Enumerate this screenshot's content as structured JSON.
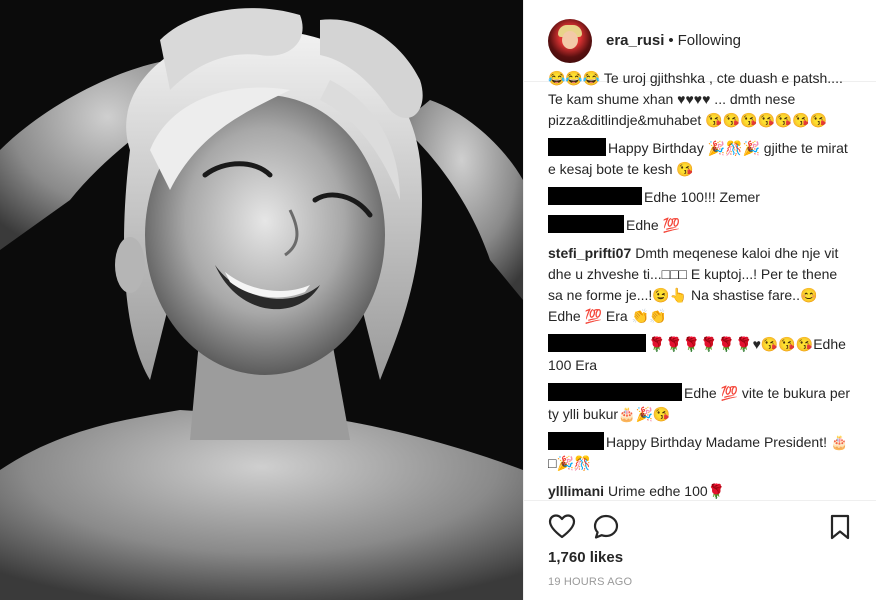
{
  "header": {
    "username": "era_rusi",
    "separator": "•",
    "follow_status": "Following"
  },
  "comments": [
    {
      "author": "",
      "text": "😂😂😂 Te uroj gjithshka , cte duash e patsh.... Te kam shume xhan ♥♥♥♥ ... dmth nese pizza&ditlindje&muhabet 😘😘😘😘😘😘😘"
    },
    {
      "author": "",
      "text": "Happy Birthday 🎉🎊🎉 gjithe te mirat e kesaj bote te kesh 😘"
    },
    {
      "author": "",
      "text": "Edhe 100!!! Zemer"
    },
    {
      "author": "",
      "text": "Edhe 💯"
    },
    {
      "author": "stefi_prifti07",
      "text": "Dmth meqenese kaloi dhe nje vit dhe u zhveshe ti...□□□ E kuptoj...! Per te thene sa ne forme je...!😉👆 Na shastise fare..😊 Edhe 💯 Era 👏👏"
    },
    {
      "author": "",
      "text": "🌹🌹🌹🌹🌹🌹♥😘😘😘Edhe 100 Era"
    },
    {
      "author": "",
      "text": "Edhe 💯 vite te bukura per ty ylli bukur🎂🎉😘"
    },
    {
      "author": "",
      "text": "Happy Birthday Madame President! 🎂□🎉🎊"
    },
    {
      "author": "ylllimani",
      "text": "Urime edhe 100🌹"
    }
  ],
  "actions": {
    "like_icon": "heart-icon",
    "comment_icon": "comment-icon",
    "save_icon": "bookmark-icon"
  },
  "likes_text": "1,760 likes",
  "timestamp": "19 HOURS AGO",
  "colors": {
    "text": "#262626",
    "muted": "#999999",
    "border": "#efefef",
    "redaction": "#000000"
  }
}
